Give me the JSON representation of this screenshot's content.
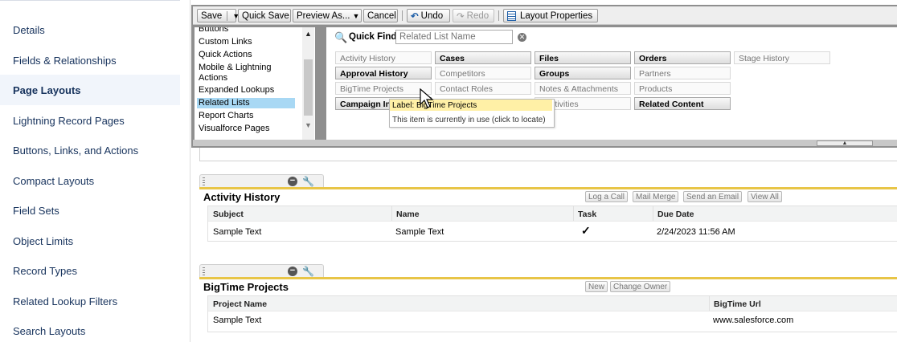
{
  "sidebar": {
    "items": [
      {
        "label": "Details"
      },
      {
        "label": "Fields & Relationships"
      },
      {
        "label": "Page Layouts",
        "active": true
      },
      {
        "label": "Lightning Record Pages"
      },
      {
        "label": "Buttons, Links, and Actions"
      },
      {
        "label": "Compact Layouts"
      },
      {
        "label": "Field Sets"
      },
      {
        "label": "Object Limits"
      },
      {
        "label": "Record Types"
      },
      {
        "label": "Related Lookup Filters"
      },
      {
        "label": "Search Layouts"
      }
    ]
  },
  "toolbar": {
    "save": "Save",
    "quick_save": "Quick Save",
    "preview_as": "Preview As...",
    "cancel": "Cancel",
    "undo": "Undo",
    "redo": "Redo",
    "layout_properties": "Layout Properties"
  },
  "palette": {
    "categories": [
      "Buttons",
      "Custom Links",
      "Quick Actions",
      "Mobile & Lightning",
      "Actions",
      "Expanded Lookups",
      "Related Lists",
      "Report Charts",
      "Visualforce Pages"
    ],
    "selected_category": "Related Lists",
    "quick_find": {
      "label": "Quick Find",
      "placeholder": "Related List Name"
    },
    "items": [
      {
        "label": "Activity History",
        "status": "used"
      },
      {
        "label": "Cases",
        "status": "available"
      },
      {
        "label": "Files",
        "status": "available"
      },
      {
        "label": "Orders",
        "status": "available"
      },
      {
        "label": "Stage History",
        "status": "used"
      },
      {
        "label": "Approval History",
        "status": "available"
      },
      {
        "label": "Competitors",
        "status": "used"
      },
      {
        "label": "Groups",
        "status": "available"
      },
      {
        "label": "Partners",
        "status": "used"
      },
      {
        "label": "BigTime Projects",
        "status": "used"
      },
      {
        "label": "Contact Roles",
        "status": "used"
      },
      {
        "label": "Notes & Attachments",
        "status": "used"
      },
      {
        "label": "Products",
        "status": "used"
      },
      {
        "label": "Campaign Inf",
        "status": "available"
      },
      {
        "label": "n Activities",
        "status": "used"
      },
      {
        "label": "Related Content",
        "status": "available"
      }
    ],
    "tooltip": {
      "label": "Label: BigTime Projects",
      "desc": "This item is currently in use (click to locate)"
    }
  },
  "sections": [
    {
      "title": "Activity History",
      "buttons": [
        "Log a Call",
        "Mail Merge",
        "Send an Email",
        "View All"
      ],
      "columns": [
        "Subject",
        "Name",
        "Task",
        "Due Date"
      ],
      "row": [
        "Sample Text",
        "Sample Text",
        "✓",
        "2/24/2023 11:56 AM"
      ]
    },
    {
      "title": "BigTime Projects",
      "buttons": [
        "New",
        "Change Owner"
      ],
      "columns": [
        "Project Name",
        "BigTime Url"
      ],
      "row": [
        "Sample Text",
        "www.salesforce.com"
      ]
    }
  ]
}
